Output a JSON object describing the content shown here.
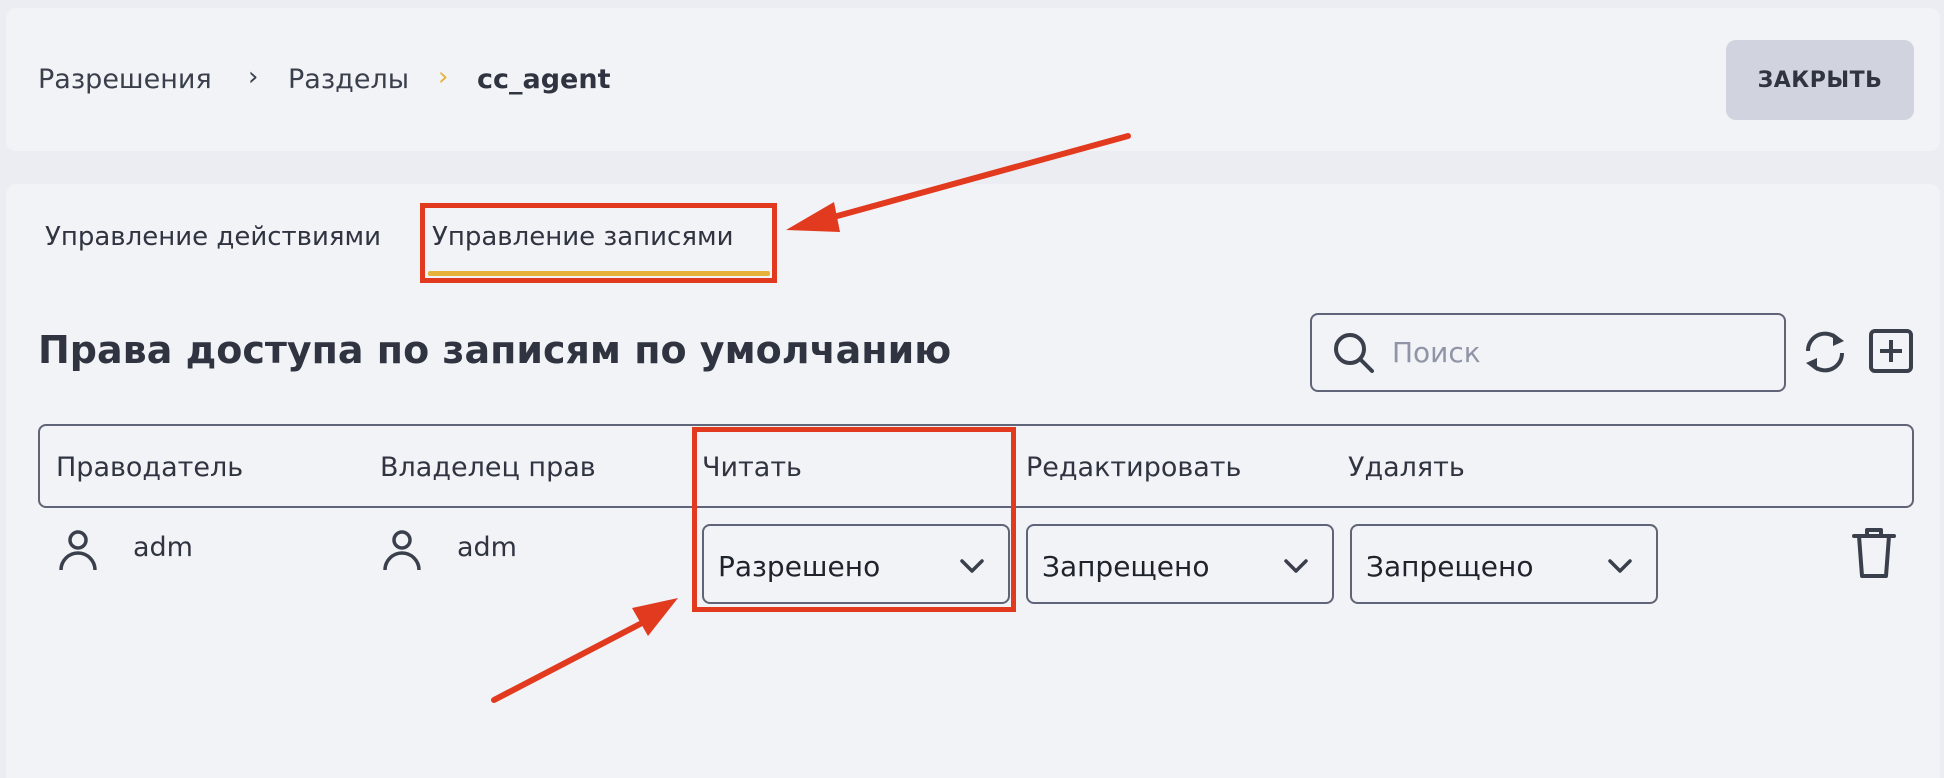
{
  "breadcrumb": {
    "items": [
      "Разрешения",
      "Разделы",
      "cc_agent"
    ]
  },
  "close_button": "ЗАКРЫТЬ",
  "tabs": [
    "Управление действиями",
    "Управление записями"
  ],
  "active_tab": "Управление записями",
  "section_title": "Права доступа по записям по умолчанию",
  "search": {
    "placeholder": "Поиск",
    "value": ""
  },
  "table": {
    "columns": [
      "Праводатель",
      "Владелец прав",
      "Читать",
      "Редактировать",
      "Удалять"
    ],
    "rows": [
      {
        "grantor": "adm",
        "grantee": "adm",
        "read": "Разрешено",
        "edit": "Запрещено",
        "delete": "Запрещено"
      }
    ]
  },
  "icons": {
    "search": "search-icon",
    "refresh": "refresh-icon",
    "add": "add-square-icon",
    "user": "user-icon",
    "chevron": "chevron-down-icon",
    "trash": "trash-icon"
  },
  "colors": {
    "accent": "#e6b23a",
    "annotation": "#e23a1e",
    "text": "#2f3440",
    "border": "#5f6478",
    "button_bg": "#d1d4de"
  }
}
